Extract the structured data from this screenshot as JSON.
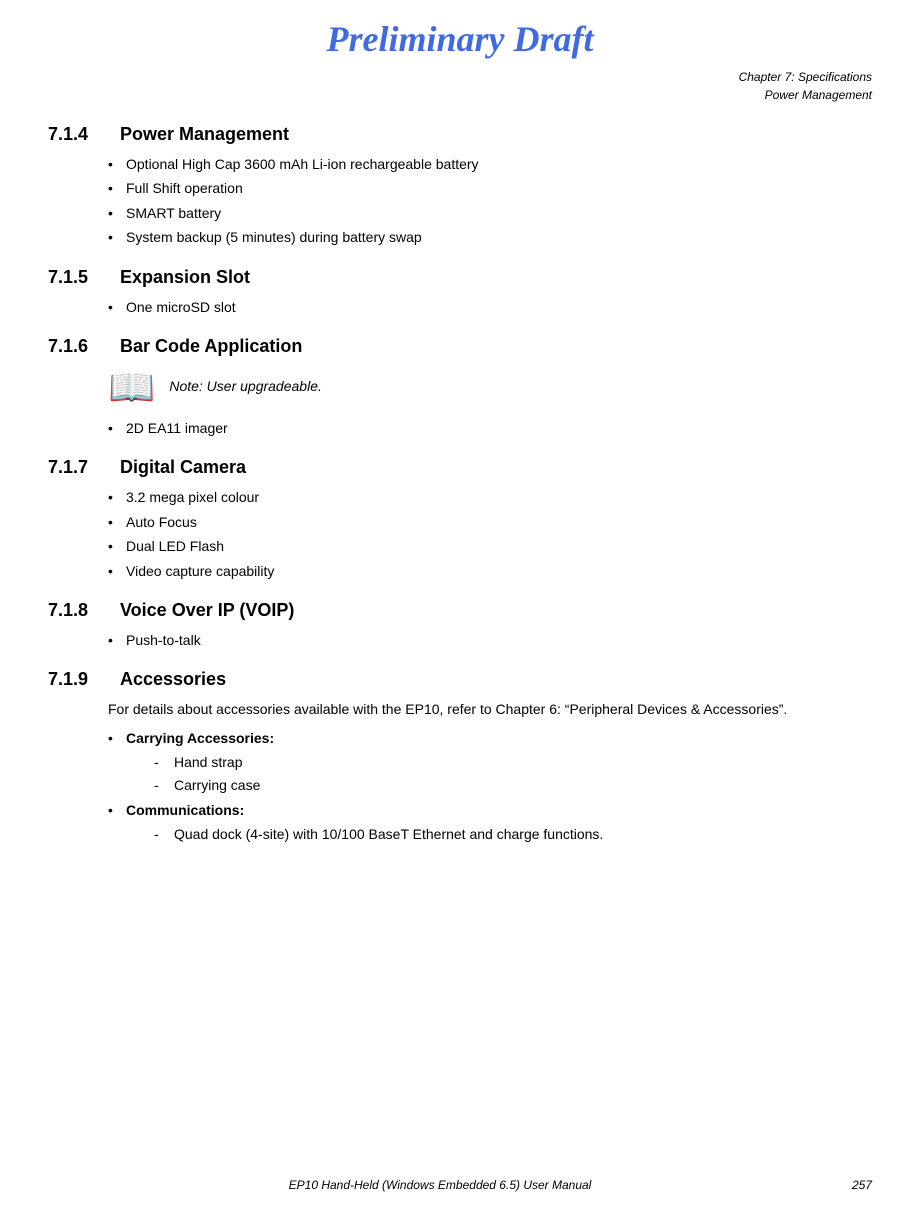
{
  "title": "Preliminary Draft",
  "header": {
    "line1": "Chapter 7:  Specifications",
    "line2": "Power Management"
  },
  "sections": [
    {
      "number": "7.1.4",
      "name": "Power Management",
      "bullets": [
        "Optional High Cap 3600 mAh Li-ion rechargeable battery",
        "Full Shift operation",
        "SMART battery",
        "System backup (5 minutes) during battery swap"
      ]
    },
    {
      "number": "7.1.5",
      "name": "Expansion Slot",
      "bullets": [
        "One microSD slot"
      ]
    },
    {
      "number": "7.1.6",
      "name": "Bar Code Application",
      "note": "Note: User upgradeable.",
      "bullets": [
        "2D EA11 imager"
      ]
    },
    {
      "number": "7.1.7",
      "name": "Digital Camera",
      "bullets": [
        "3.2 mega pixel colour",
        "Auto Focus",
        "Dual LED Flash",
        "Video capture capability"
      ]
    },
    {
      "number": "7.1.8",
      "name": "Voice Over IP (VOIP)",
      "bullets": [
        "Push-to-talk"
      ]
    },
    {
      "number": "7.1.9",
      "name": " Accessories",
      "para": "For details about accessories available with the EP10, refer to Chapter 6: “Peripheral Devices & Accessories”.",
      "accessories": [
        {
          "label": "Carrying Accessories:",
          "dashes": [
            "Hand strap",
            "Carrying case"
          ]
        },
        {
          "label": "Communications:",
          "dashes": [
            "Quad dock (4-site) with 10/100 BaseT Ethernet and charge functions."
          ]
        }
      ]
    }
  ],
  "footer": {
    "left": "",
    "center": "EP10 Hand-Held (Windows Embedded 6.5) User Manual",
    "page": "257"
  }
}
